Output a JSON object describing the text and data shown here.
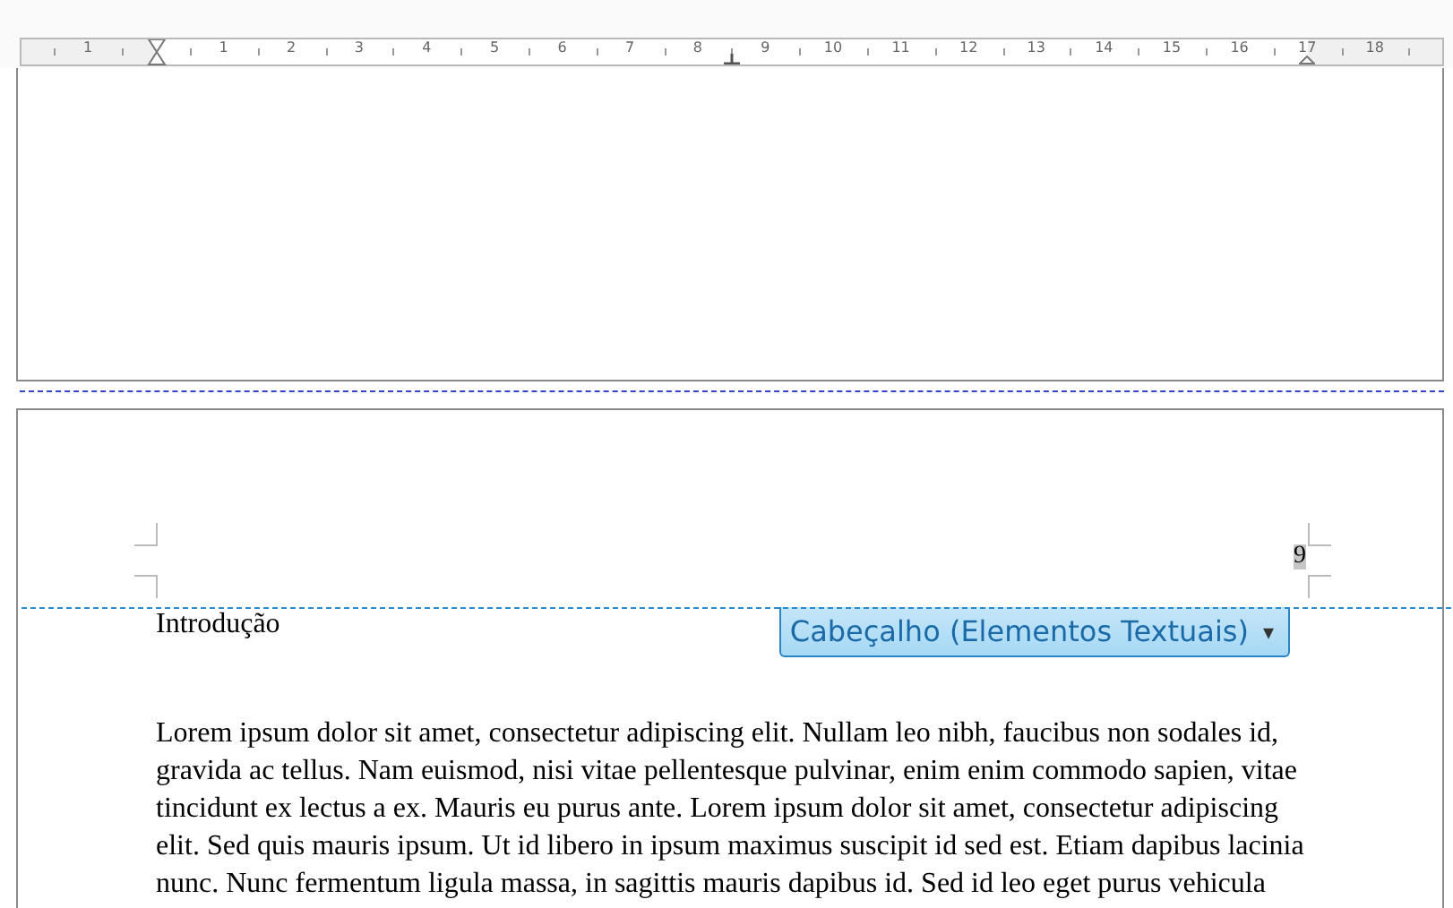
{
  "ruler": {
    "labels": [
      "1",
      "1",
      "2",
      "3",
      "4",
      "5",
      "6",
      "7",
      "8",
      "9",
      "10",
      "11",
      "12",
      "13",
      "14",
      "15",
      "16",
      "17",
      "18"
    ]
  },
  "header": {
    "page_number": "9"
  },
  "heading": "Introdução",
  "header_dropdown": {
    "label": "Cabeçalho (Elementos Textuais)",
    "arrow": "▾"
  },
  "body_lines": [
    "Lorem ipsum dolor sit amet, consectetur adipiscing elit. Nullam leo nibh, faucibus non sodales id,",
    "gravida ac tellus. Nam euismod, nisi vitae pellentesque pulvinar, enim enim commodo sapien, vitae",
    "tincidunt ex lectus a ex. Mauris eu purus ante. Lorem ipsum dolor sit amet, consectetur adipiscing",
    "elit. Sed quis mauris ipsum. Ut id libero in ipsum maximus suscipit id sed est. Etiam dapibus lacinia",
    "nunc. Nunc fermentum ligula massa, in sagittis mauris dapibus id. Sed id leo eget purus vehicula"
  ]
}
